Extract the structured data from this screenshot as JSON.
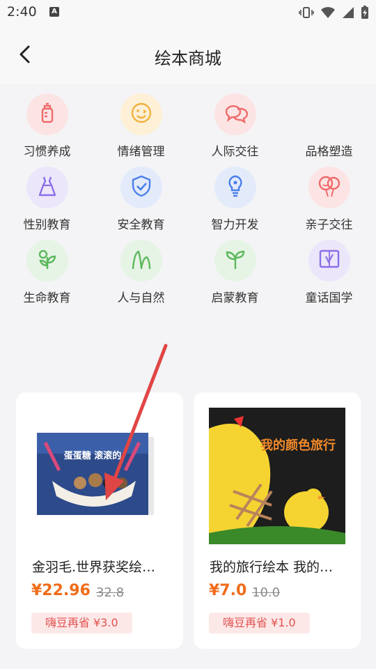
{
  "status": {
    "time": "2:40",
    "a_badge": "A"
  },
  "header": {
    "title": "绘本商城"
  },
  "categories": [
    {
      "label": "习惯养成",
      "icon": "baby-bottle-icon",
      "color": "#ef6a6a",
      "bg": "#fde4e4"
    },
    {
      "label": "情绪管理",
      "icon": "smiley-face-icon",
      "color": "#f2b13d",
      "bg": "#fdf0d6"
    },
    {
      "label": "人际交往",
      "icon": "chat-bubbles-icon",
      "color": "#ef6a6a",
      "bg": "#fde4e4"
    },
    {
      "label": "品格塑造",
      "icon": "",
      "color": "#999999",
      "bg": "#f4f4f6"
    },
    {
      "label": "性别教育",
      "icon": "dress-icon",
      "color": "#8b6ee8",
      "bg": "#ece6fb"
    },
    {
      "label": "安全教育",
      "icon": "shield-check-icon",
      "color": "#4a7ee8",
      "bg": "#e3ebfb"
    },
    {
      "label": "智力开发",
      "icon": "lightbulb-icon",
      "color": "#4a7ee8",
      "bg": "#e3ebfb"
    },
    {
      "label": "亲子交往",
      "icon": "balloons-icon",
      "color": "#ef6a6a",
      "bg": "#fde4e4"
    },
    {
      "label": "生命教育",
      "icon": "plant-icon",
      "color": "#5cb85c",
      "bg": "#e6f4e6"
    },
    {
      "label": "人与自然",
      "icon": "grass-icon",
      "color": "#5cb85c",
      "bg": "#e6f4e6"
    },
    {
      "label": "启蒙教育",
      "icon": "sprout-icon",
      "color": "#5cb85c",
      "bg": "#e6f4e6"
    },
    {
      "label": "童话国学",
      "icon": "open-book-icon",
      "color": "#8b6ee8",
      "bg": "#ece6fb"
    }
  ],
  "products": [
    {
      "name": "金羽毛.世界获奖绘…",
      "price": "¥22.96",
      "old_price": "32.8",
      "badge": "嗨豆再省 ¥3.0",
      "cover_text": "蛋蛋糖 滚滚的"
    },
    {
      "name": "我的旅行绘本 我的…",
      "price": "¥7.0",
      "old_price": "10.0",
      "badge": "嗨豆再省 ¥1.0",
      "cover_text": "我的颜色旅行"
    }
  ],
  "colors": {
    "price": "#f06c1a",
    "badge_text": "#e2524f",
    "arrow": "#e04545"
  }
}
